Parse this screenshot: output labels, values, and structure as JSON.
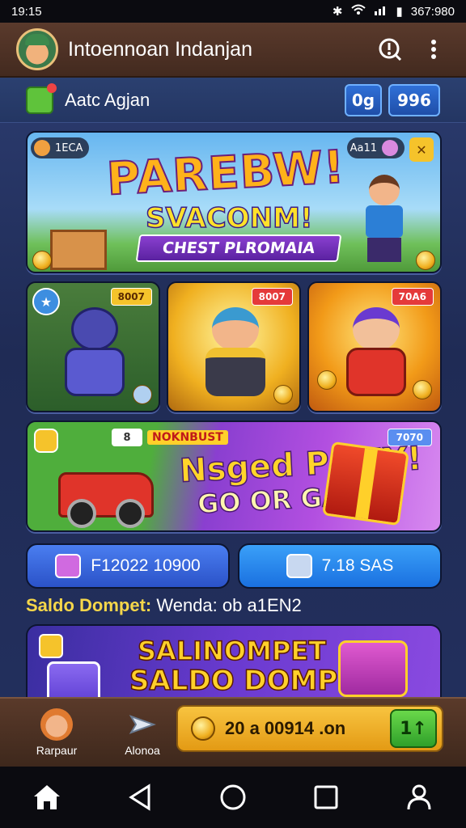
{
  "status": {
    "time": "19:15",
    "right": "367:980"
  },
  "appbar": {
    "title": "Intoennoan Indanjan",
    "info_icon": "info-icon",
    "menu_icon": "more-vert-icon"
  },
  "subheader": {
    "title": "Aatc Agjan",
    "pill1": "0g",
    "pill2": "996"
  },
  "banner": {
    "chip_left": "1ECA",
    "chip_right": "Aa11",
    "title": "PAREBW!",
    "subtitle": "SVACONM!",
    "ribbon": "CHEST PLROMAIA"
  },
  "tiles": [
    {
      "badge": "8007"
    },
    {
      "badge": "8007"
    },
    {
      "badge": "70A6"
    }
  ],
  "promo": {
    "num": "8",
    "tag": "NOKNBUST",
    "badge": "7070",
    "title": "Nsged PONY!",
    "subtitle": "GO OR GAMG!"
  },
  "actions": {
    "left": "F12022 10900",
    "right": "7.18 SAS"
  },
  "balance": {
    "label": "Saldo Dompet:",
    "value": "Wenda: ob a1EN2"
  },
  "wallet": {
    "title": "SALINOMPET",
    "subtitle": "SALDO DOMPET!"
  },
  "bottom": {
    "nav1": "Rarpaur",
    "nav2": "Alonoa",
    "claim": "20 a 00914 .on",
    "go": "1↑"
  },
  "colors": {
    "accent": "#f5c32b",
    "appbar": "#4b2f23",
    "primary_blue": "#2b62d8"
  }
}
